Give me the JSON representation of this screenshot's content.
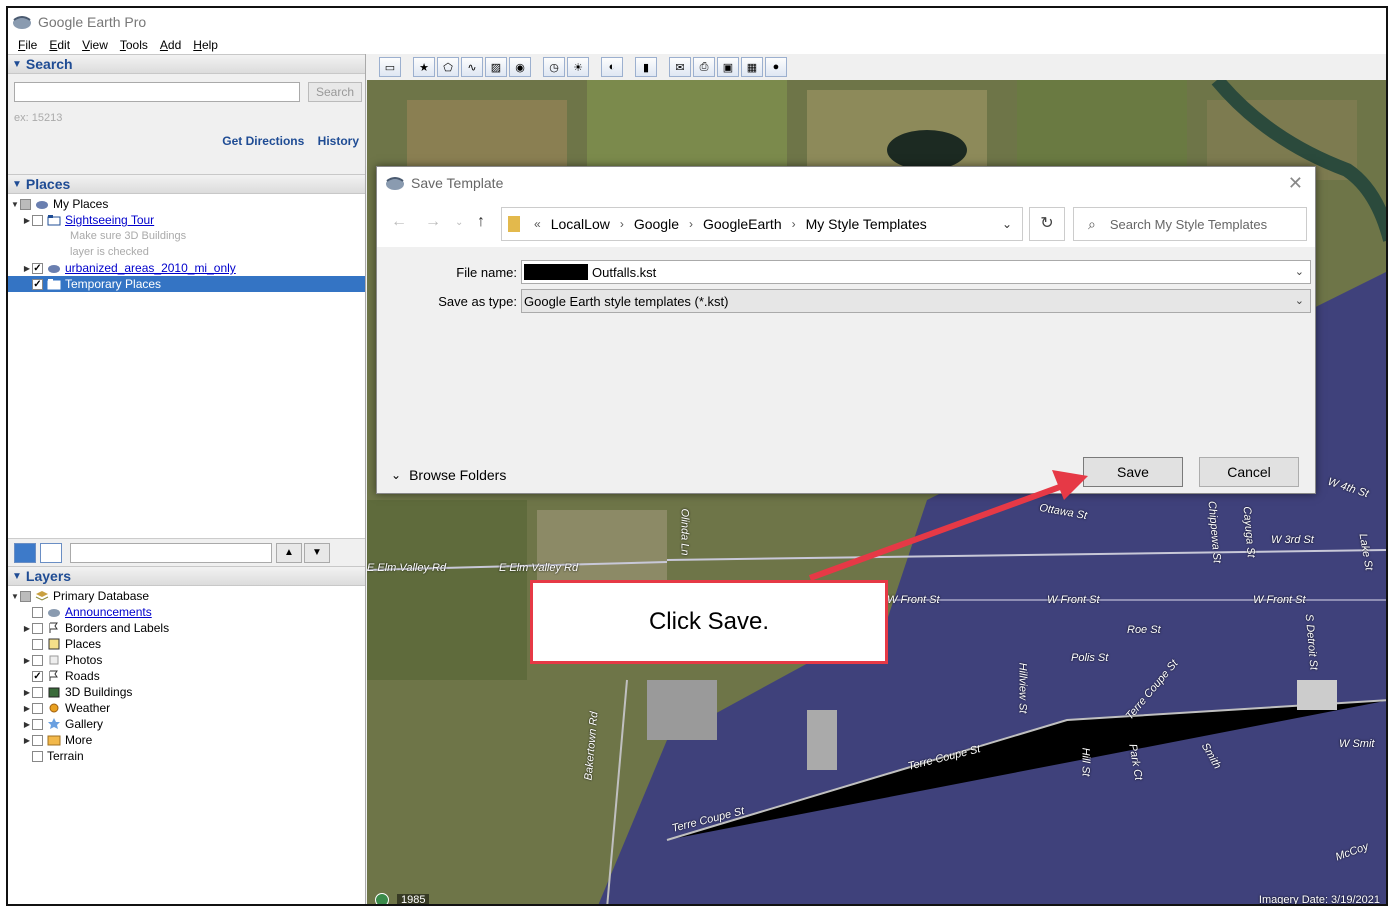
{
  "app": {
    "title": "Google Earth Pro"
  },
  "menu": [
    "File",
    "Edit",
    "View",
    "Tools",
    "Add",
    "Help"
  ],
  "search": {
    "header": "Search",
    "button": "Search",
    "hint": "ex: 15213",
    "get_directions": "Get Directions",
    "history": "History"
  },
  "places": {
    "header": "Places",
    "my_places": "My Places",
    "sightseeing": "Sightseeing Tour",
    "note_line1": "Make sure 3D Buildings",
    "note_line2": "layer is checked",
    "urbanized": "urbanized_areas_2010_mi_only",
    "temporary": "Temporary Places"
  },
  "layers": {
    "header": "Layers",
    "items": [
      "Primary Database",
      "Announcements",
      "Borders and Labels",
      "Places",
      "Photos",
      "Roads",
      "3D Buildings",
      "Weather",
      "Gallery",
      "More",
      "Terrain"
    ]
  },
  "map": {
    "year": "1985",
    "imagery_date": "Imagery Date: 3/19/2021",
    "roads": [
      "E Elm Valley Rd",
      "E Elm Valley Rd",
      "W Front St",
      "W Front St",
      "W Front St",
      "Roe St",
      "Polis St",
      "Terre Coupe St",
      "Terre Coupe St",
      "Terre Coupe St",
      "Hillview St",
      "Hill St",
      "Park Ct",
      "Smith",
      "W Smit",
      "McCoy",
      "W 3rd St",
      "W 4th St",
      "Lake St",
      "S Detroit St",
      "Chippewa St",
      "Cayuga St",
      "Bakertown Rd",
      "Ottawa St",
      "Olinda Ln"
    ]
  },
  "dialog": {
    "title": "Save Template",
    "breadcrumb": [
      "LocalLow",
      "Google",
      "GoogleEarth",
      "My Style Templates"
    ],
    "search_placeholder": "Search My Style Templates",
    "file_name_label": "File name:",
    "file_name_value": "Outfalls.kst",
    "save_type_label": "Save as type:",
    "save_type_value": "Google Earth style templates (*.kst)",
    "browse_folders": "Browse Folders",
    "save": "Save",
    "cancel": "Cancel"
  },
  "callout": {
    "text": "Click Save."
  },
  "colors": {
    "accent": "#3474c4",
    "callout_red": "#e63946",
    "link": "#0000cc"
  }
}
